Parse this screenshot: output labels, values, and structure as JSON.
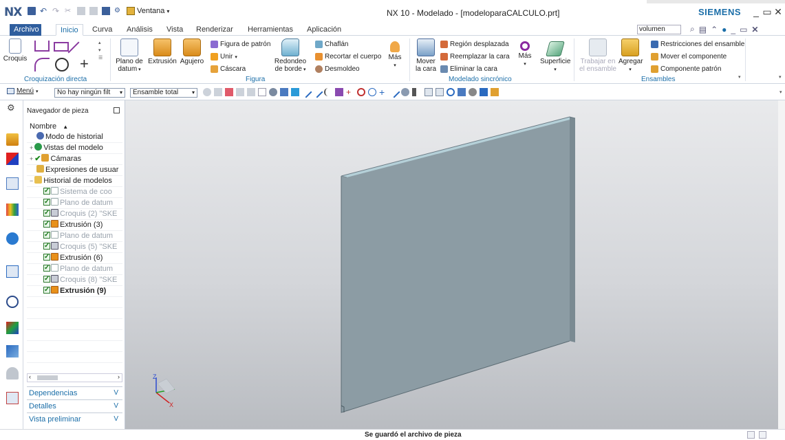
{
  "app": {
    "logo": "NX",
    "window_menu": "Ventana",
    "title": "NX 10 - Modelado - [modeloparaCALCULO.prt]",
    "brand": "SIEMENS"
  },
  "tabs": [
    "Archivo",
    "Inicio",
    "Curva",
    "Análisis",
    "Vista",
    "Renderizar",
    "Herramientas",
    "Aplicación"
  ],
  "active_tab": "Inicio",
  "search": {
    "value": "volumen"
  },
  "ribbon": {
    "sketch": {
      "label": "Croquis"
    },
    "groups": {
      "direct_sketch": "Croquización directa",
      "feature": "Figura",
      "sync_modeling": "Modelado sincrónico",
      "assemblies": "Ensambles"
    },
    "feature_buttons": {
      "datum_plane_l1": "Plano de",
      "datum_plane_l2": "datum",
      "extrude": "Extrusión",
      "hole": "Agujero",
      "pattern_feature": "Figura de patrón",
      "unite": "Unir",
      "shell": "Cáscara",
      "edge_blend_l1": "Redondeo",
      "edge_blend_l2": "de borde",
      "chamfer": "Chaflán",
      "trim_body": "Recortar el cuerpo",
      "draft": "Desmoldeo",
      "more": "Más"
    },
    "sync_buttons": {
      "move_face_l1": "Mover",
      "move_face_l2": "la cara",
      "offset_region": "Región desplazada",
      "replace_face": "Reemplazar la cara",
      "delete_face": "Eliminar la cara",
      "more": "Más",
      "surface": "Superficie"
    },
    "assembly_buttons": {
      "work_in_assembly_l1": "Trabajar en",
      "work_in_assembly_l2": "el ensamble",
      "add": "Agregar",
      "constraints": "Restricciones del ensamble",
      "move_component": "Mover el componente",
      "pattern_component": "Componente patrón"
    }
  },
  "selection_bar": {
    "menu": "Menú",
    "filter": "No hay ningún filt",
    "scope": "Ensamble total"
  },
  "navigator": {
    "title": "Navegador de pieza",
    "column": "Nombre",
    "rows": [
      {
        "label": "Modo de historial",
        "style": "normal"
      },
      {
        "label": "Vistas del modelo",
        "style": "normal"
      },
      {
        "label": "Cámaras",
        "style": "normal"
      },
      {
        "label": "Expresiones de usuar",
        "style": "normal"
      },
      {
        "label": "Historial de modelos",
        "style": "normal"
      },
      {
        "label": "Sistema de coo",
        "style": "grey"
      },
      {
        "label": "Plano de datum",
        "style": "grey"
      },
      {
        "label": "Croquis (2) \"SKE",
        "style": "grey"
      },
      {
        "label": "Extrusión (3)",
        "style": "normal"
      },
      {
        "label": "Plano de datum",
        "style": "grey"
      },
      {
        "label": "Croquis (5) \"SKE",
        "style": "grey"
      },
      {
        "label": "Extrusión (6)",
        "style": "normal"
      },
      {
        "label": "Plano de datum",
        "style": "grey"
      },
      {
        "label": "Croquis (8) \"SKE",
        "style": "grey"
      },
      {
        "label": "Extrusión (9)",
        "style": "bold"
      }
    ],
    "panels": [
      "Dependencias",
      "Detalles",
      "Vista preliminar"
    ]
  },
  "viewport": {
    "triad_z": "Z",
    "triad_x": "X"
  },
  "status": {
    "message": "Se guardó el archivo de pieza"
  },
  "colors": {
    "accent": "#1b6ea8",
    "file_tab": "#2f5e9e",
    "part_face": "#8c9ca4",
    "part_edge": "#a9c8d2"
  }
}
